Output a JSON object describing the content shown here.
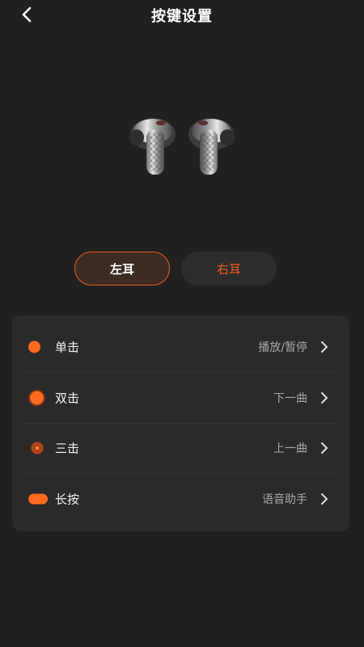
{
  "header": {
    "title": "按键设置"
  },
  "tabs": [
    {
      "label": "左耳",
      "active": true
    },
    {
      "label": "右耳",
      "active": false
    }
  ],
  "settings": {
    "rows": [
      {
        "label": "单击",
        "value": "播放/暂停",
        "icon": "single-tap-icon"
      },
      {
        "label": "双击",
        "value": "下一曲",
        "icon": "double-tap-icon"
      },
      {
        "label": "三击",
        "value": "上一曲",
        "icon": "triple-tap-icon"
      },
      {
        "label": "长按",
        "value": "语音助手",
        "icon": "long-press-icon"
      }
    ]
  },
  "colors": {
    "accent": "#ff6a1f",
    "background": "#202020",
    "card": "#2a2a2a"
  }
}
